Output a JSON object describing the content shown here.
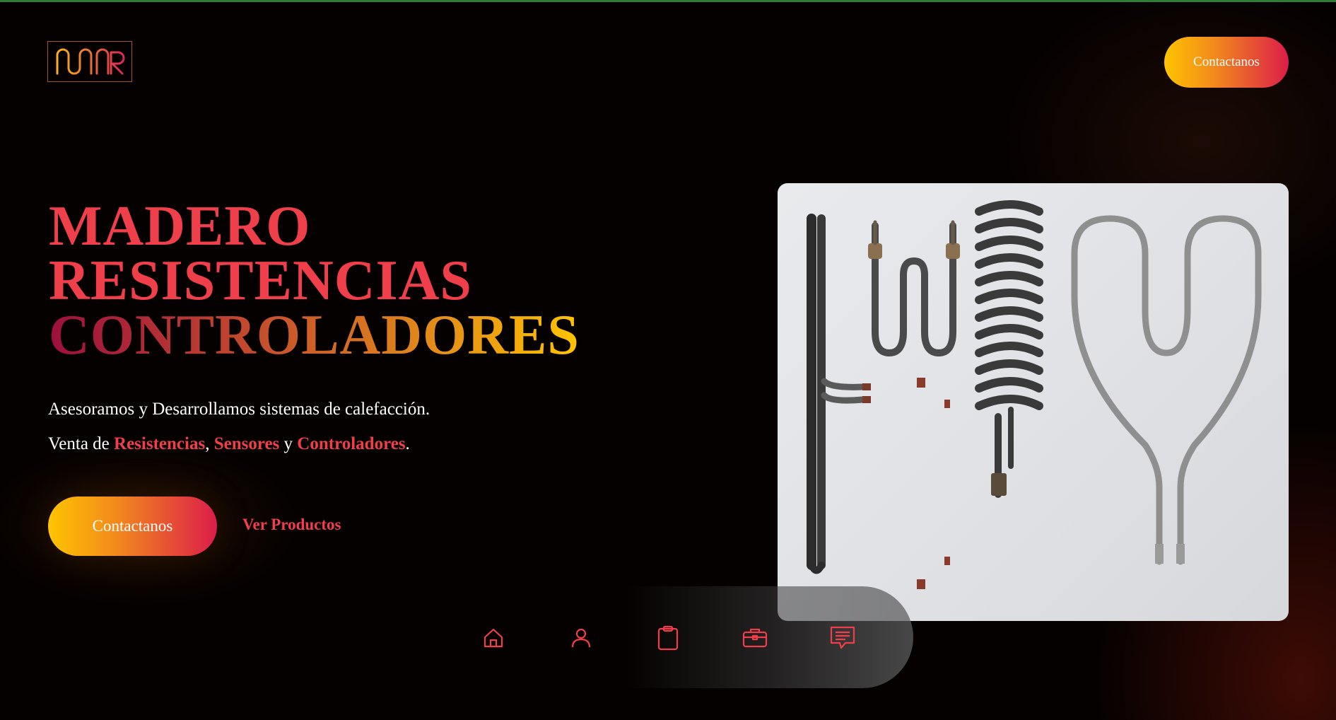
{
  "header": {
    "logo_text": "MR",
    "cta_label": "Contactanos"
  },
  "hero": {
    "title_line1": "MADERO",
    "title_line2": "RESISTENCIAS",
    "title_line3": "CONTROLADORES",
    "subtitle": "Asesoramos y Desarrollamos sistemas de calefacción.",
    "sales_prefix": "Venta de ",
    "sales_item1": "Resistencias",
    "sales_sep1": ", ",
    "sales_item2": "Sensores",
    "sales_sep2": " y ",
    "sales_item3": "Controladores",
    "sales_end": ".",
    "primary_cta": "Contactanos",
    "secondary_cta": "Ver Productos"
  },
  "dock": {
    "items": [
      {
        "icon": "home-icon"
      },
      {
        "icon": "user-icon"
      },
      {
        "icon": "clipboard-icon"
      },
      {
        "icon": "briefcase-icon"
      },
      {
        "icon": "chat-icon"
      }
    ]
  },
  "colors": {
    "accent_red": "#ef3f4a",
    "gradient_start": "#ffc400",
    "gradient_end": "#dc1d49",
    "background": "#050101"
  }
}
